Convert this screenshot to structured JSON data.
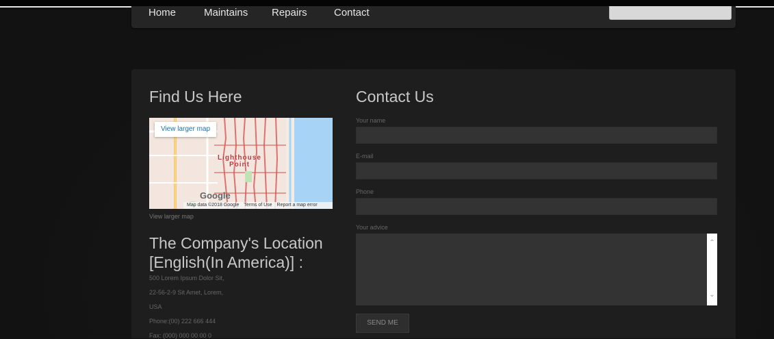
{
  "nav": {
    "items": [
      "Home",
      "Maintains",
      "Repairs",
      "Contact"
    ],
    "search_value": ""
  },
  "find_us": {
    "title": "Find Us Here",
    "map": {
      "view_larger_button": "View larger map",
      "place_label_line1": "Lighthouse",
      "place_label_line2": "Point",
      "google_logo": "Google",
      "footer_data": "Map data ©2018 Google",
      "footer_terms": "Terms of Use",
      "footer_report": "Report a map error"
    },
    "view_larger_link": "View larger map",
    "location_title": "The Company's Location [English(In America)] :",
    "address_lines": [
      "500 Lorem Ipsum Dolor Sit,",
      "22-56-2-9 Sit Amet, Lorem,",
      "USA",
      "Phone:(00) 222 666 444",
      "Fax: (000) 000 00 00 0"
    ]
  },
  "contact": {
    "title": "Contact Us",
    "name_label": "Your name",
    "email_label": "E-mail",
    "phone_label": "Phone",
    "advice_label": "Your advice",
    "send_label": "SEND ME"
  },
  "colors": {
    "background": "#121212",
    "panel": "#1e1e1e",
    "nav": "#252525",
    "field": "#333333",
    "heading": "#c8c8c8"
  }
}
